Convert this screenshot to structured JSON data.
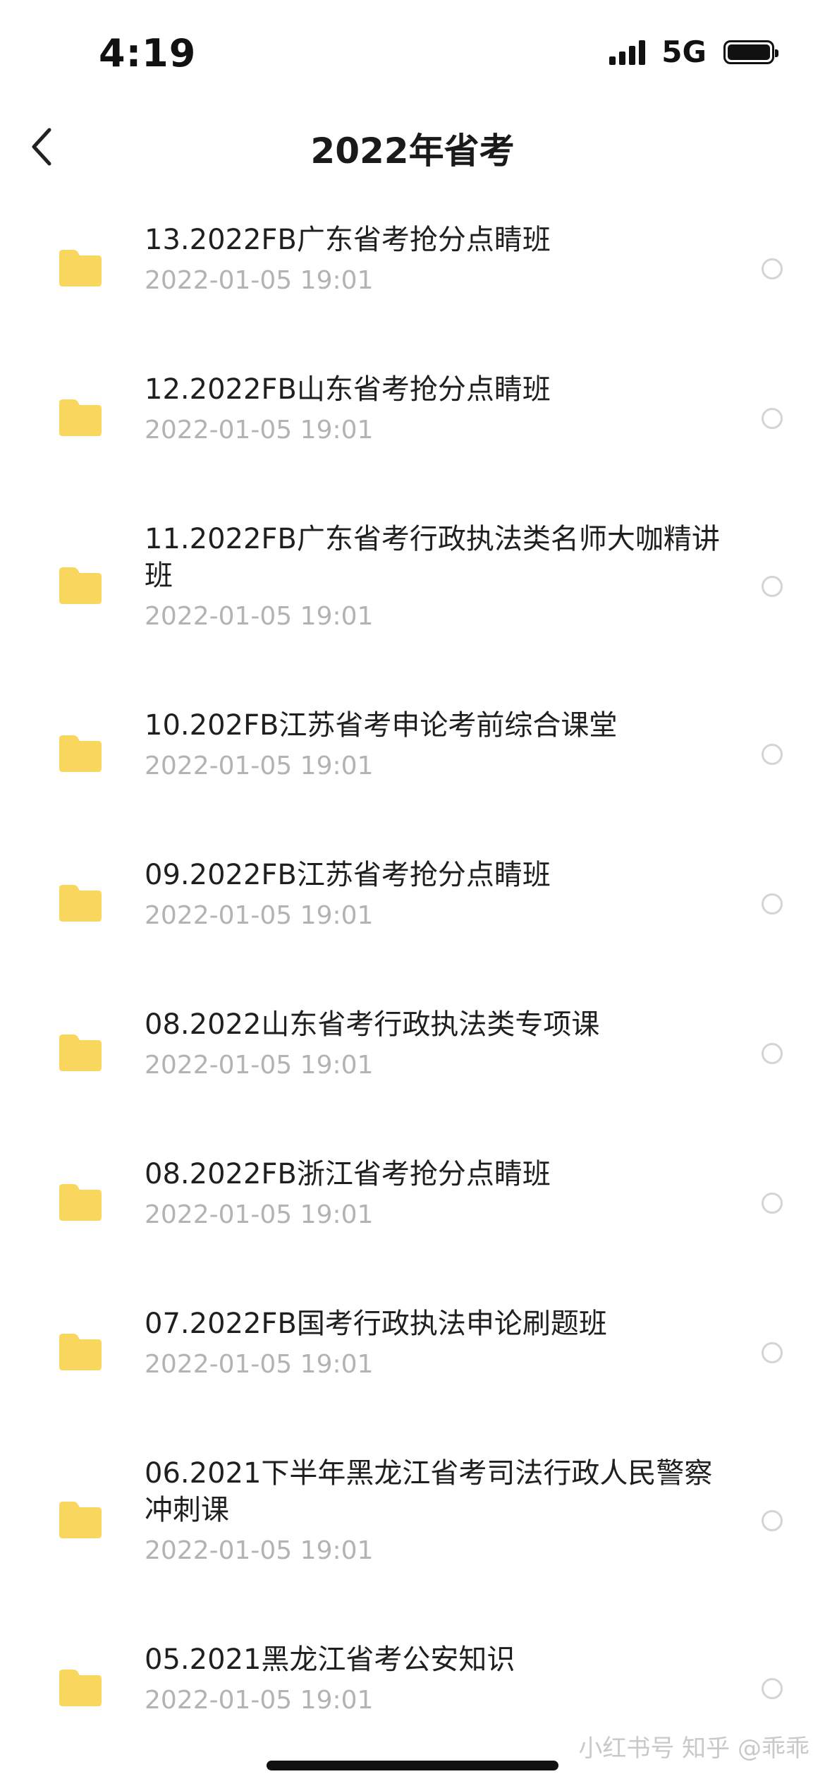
{
  "status_bar": {
    "time": "4:19",
    "network": "5G"
  },
  "header": {
    "title": "2022年省考"
  },
  "colors": {
    "folder": "#F9D65E",
    "date_text": "#B3B3B3",
    "radio_border": "#D4D4D4"
  },
  "files": [
    {
      "name": "13.2022FB广东省考抢分点睛班",
      "date": "2022-01-05 19:01"
    },
    {
      "name": "12.2022FB山东省考抢分点睛班",
      "date": "2022-01-05 19:01"
    },
    {
      "name": "11.2022FB广东省考行政执法类名师大咖精讲班",
      "date": "2022-01-05 19:01"
    },
    {
      "name": "10.202FB江苏省考申论考前综合课堂",
      "date": "2022-01-05 19:01"
    },
    {
      "name": "09.2022FB江苏省考抢分点睛班",
      "date": "2022-01-05 19:01"
    },
    {
      "name": "08.2022山东省考行政执法类专项课",
      "date": "2022-01-05 19:01"
    },
    {
      "name": "08.2022FB浙江省考抢分点睛班",
      "date": "2022-01-05 19:01"
    },
    {
      "name": "07.2022FB国考行政执法申论刷题班",
      "date": "2022-01-05 19:01"
    },
    {
      "name": "06.2021下半年黑龙江省考司法行政人民警察冲刺课",
      "date": "2022-01-05 19:01"
    },
    {
      "name": "05.2021黑龙江省考公安知识",
      "date": "2022-01-05 19:01"
    }
  ],
  "watermark": "小红书号 知乎 @乖乖"
}
